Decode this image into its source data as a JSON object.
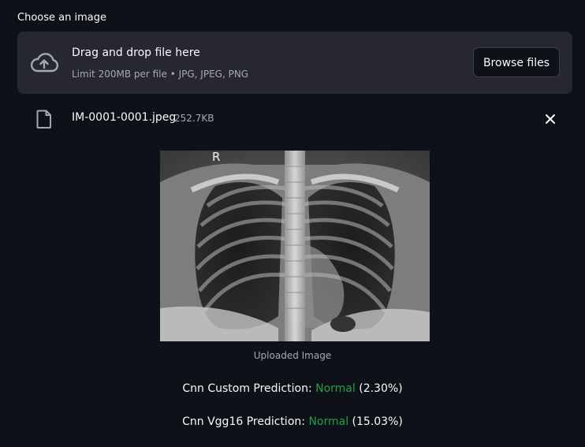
{
  "uploader": {
    "label": "Choose an image",
    "title": "Drag and drop file here",
    "limit_text": "Limit 200MB per file • JPG, JPEG, PNG",
    "browse_label": "Browse files",
    "cloud_icon": "cloud-upload-icon"
  },
  "file": {
    "name": "IM-0001-0001.jpeg",
    "size": "252.7KB",
    "icon": "file-icon",
    "close_icon": "close-icon"
  },
  "image": {
    "marker": "R",
    "caption": "Uploaded Image"
  },
  "predictions": [
    {
      "label": "Cnn Custom Prediction: ",
      "result": "Normal",
      "confidence": " (2.30%)"
    },
    {
      "label": "Cnn Vgg16 Prediction: ",
      "result": "Normal",
      "confidence": " (15.03%)"
    }
  ],
  "colors": {
    "background": "#0e1117",
    "dropzone": "#262730",
    "result_green": "#21a144",
    "muted_text": "#a3a8b8"
  }
}
